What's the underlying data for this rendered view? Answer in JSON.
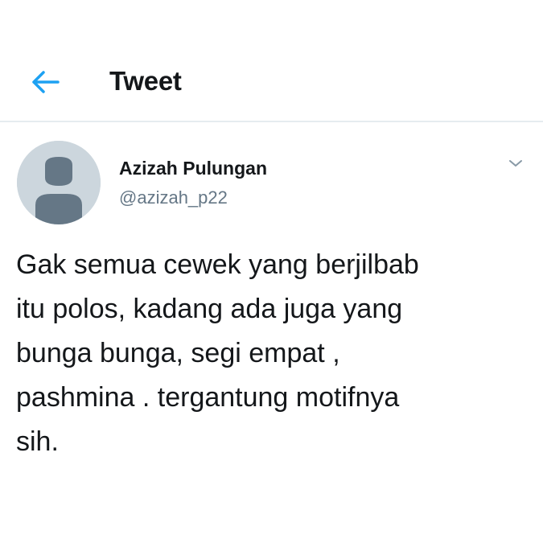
{
  "header": {
    "title": "Tweet",
    "back_icon": "arrow-left-icon",
    "accent_color": "#1da1f2"
  },
  "tweet": {
    "author_name": "Azizah Pulungan",
    "author_handle": "@azizah_p22",
    "avatar_icon": "default-user-avatar",
    "menu_icon": "chevron-down-icon",
    "text": "Gak semua cewek yang berjilbab\nitu polos, kadang ada juga yang\nbunga bunga, segi empat ,\npashmina . tergantung motifnya\nsih."
  }
}
